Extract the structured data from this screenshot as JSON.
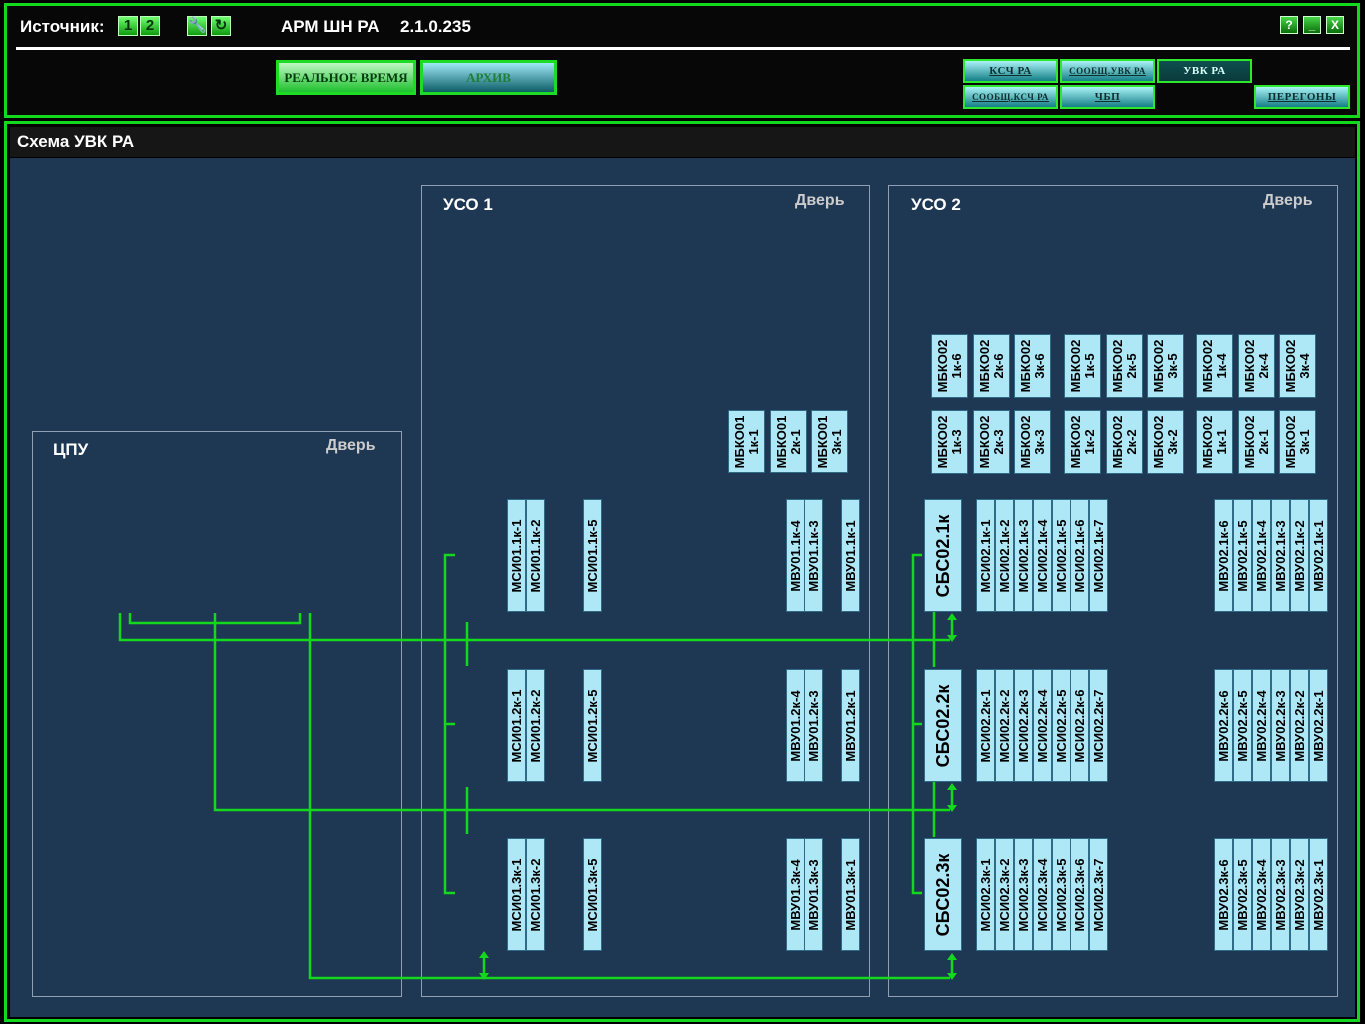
{
  "header": {
    "source_label": "Источник:",
    "source_btn_1": "1",
    "source_btn_2": "2",
    "app_title": "АРМ ШН РА",
    "version": "2.1.0.235",
    "tool_icons": [
      "wrench-icon",
      "refresh-icon"
    ],
    "window_buttons": {
      "help": "?",
      "minimize": "_",
      "close": "X"
    },
    "mode_buttons": {
      "realtime": "РЕАЛЬНОЕ ВРЕМЯ",
      "archive": "АРХИВ"
    },
    "nav": {
      "ksch_ra": "КСЧ РА",
      "soob_uvk_ra": "СООБЩ.УВК РА",
      "uvk_ra": "УВК РА",
      "soob_ksch_ra": "СООБЩ.КСЧ РА",
      "chbp": "ЧБП",
      "peregony": "ПЕРЕГОНЫ"
    }
  },
  "panel": {
    "title": "Схема УВК РА"
  },
  "cabinets": {
    "cpu": {
      "name": "ЦПУ",
      "door": "Дверь"
    },
    "uso1": {
      "name": "УСО 1",
      "door": "Дверь"
    },
    "uso2": {
      "name": "УСО 2",
      "door": "Дверь"
    }
  },
  "modules": {
    "mbko01": [
      "МБКО01\n1к-1",
      "МБКО01\n2к-1",
      "МБКО01\n3к-1"
    ],
    "mbko02_top": [
      "МБКО02\n1к-6",
      "МБКО02\n2к-6",
      "МБКО02\n3к-6",
      "МБКО02\n1к-5",
      "МБКО02\n2к-5",
      "МБКО02\n3к-5",
      "МБКО02\n1к-4",
      "МБКО02\n2к-4",
      "МБКО02\n3к-4"
    ],
    "mbko02_bottom": [
      "МБКО02\n1к-3",
      "МБКО02\n2к-3",
      "МБКО02\n3к-3",
      "МБКО02\n1к-2",
      "МБКО02\n2к-2",
      "МБКО02\n3к-2",
      "МБКО02\n1к-1",
      "МБКО02\n2к-1",
      "МБКО02\n3к-1"
    ],
    "uso1_rows": [
      [
        "МСИ01.1к-1",
        "МСИ01.1к-2",
        "МСИ01.1к-5",
        "МВУ01.1к-4",
        "МВУ01.1к-3",
        "МВУ01.1к-1"
      ],
      [
        "МСИ01.2к-1",
        "МСИ01.2к-2",
        "МСИ01.2к-5",
        "МВУ01.2к-4",
        "МВУ01.2к-3",
        "МВУ01.2к-1"
      ],
      [
        "МСИ01.3к-1",
        "МСИ01.3к-2",
        "МСИ01.3к-5",
        "МВУ01.3к-4",
        "МВУ01.3к-3",
        "МВУ01.3к-1"
      ]
    ],
    "sbs": [
      "СБС02.1к",
      "СБС02.2к",
      "СБС02.3к"
    ],
    "msi02_rows": [
      [
        "МСИ02.1к-1",
        "МСИ02.1к-2",
        "МСИ02.1к-3",
        "МСИ02.1к-4",
        "МСИ02.1к-5",
        "МСИ02.1к-6",
        "МСИ02.1к-7"
      ],
      [
        "МСИ02.2к-1",
        "МСИ02.2к-2",
        "МСИ02.2к-3",
        "МСИ02.2к-4",
        "МСИ02.2к-5",
        "МСИ02.2к-6",
        "МСИ02.2к-7"
      ],
      [
        "МСИ02.3к-1",
        "МСИ02.3к-2",
        "МСИ02.3к-3",
        "МСИ02.3к-4",
        "МСИ02.3к-5",
        "МСИ02.3к-6",
        "МСИ02.3к-7"
      ]
    ],
    "mvu02_rows": [
      [
        "МВУ02.1к-6",
        "МВУ02.1к-5",
        "МВУ02.1к-4",
        "МВУ02.1к-3",
        "МВУ02.1к-2",
        "МВУ02.1к-1"
      ],
      [
        "МВУ02.2к-6",
        "МВУ02.2к-5",
        "МВУ02.2к-4",
        "МВУ02.2к-3",
        "МВУ02.2к-2",
        "МВУ02.2к-1"
      ],
      [
        "МВУ02.3к-6",
        "МВУ02.3к-5",
        "МВУ02.3к-4",
        "МВУ02.3к-3",
        "МВУ02.3к-2",
        "МВУ02.3к-1"
      ]
    ]
  },
  "colors": {
    "frame_green": "#14d81e",
    "canvas_bg": "#1e3752",
    "module_bg": "#aee8f7",
    "link_green": "#14d81e"
  }
}
